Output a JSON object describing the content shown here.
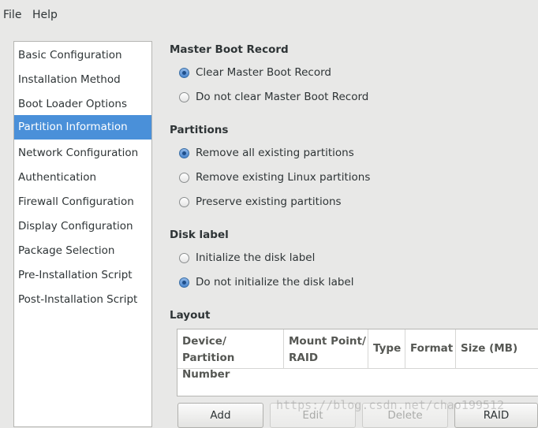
{
  "menu": {
    "file": "File",
    "help": "Help"
  },
  "sidebar": {
    "items": [
      {
        "label": "Basic Configuration",
        "selected": false
      },
      {
        "label": "Installation Method",
        "selected": false
      },
      {
        "label": "Boot Loader Options",
        "selected": false
      },
      {
        "label": "Partition Information",
        "selected": true
      },
      {
        "label": "Network Configuration",
        "selected": false
      },
      {
        "label": "Authentication",
        "selected": false
      },
      {
        "label": "Firewall Configuration",
        "selected": false
      },
      {
        "label": "Display Configuration",
        "selected": false
      },
      {
        "label": "Package Selection",
        "selected": false
      },
      {
        "label": "Pre-Installation Script",
        "selected": false
      },
      {
        "label": "Post-Installation Script",
        "selected": false
      }
    ]
  },
  "mbr": {
    "title": "Master Boot Record",
    "options": [
      {
        "label": "Clear Master Boot Record",
        "checked": true
      },
      {
        "label": "Do not clear Master Boot Record",
        "checked": false
      }
    ]
  },
  "partitions": {
    "title": "Partitions",
    "options": [
      {
        "label": "Remove all existing partitions",
        "checked": true
      },
      {
        "label": "Remove existing Linux partitions",
        "checked": false
      },
      {
        "label": "Preserve existing partitions",
        "checked": false
      }
    ]
  },
  "disklabel": {
    "title": "Disk label",
    "options": [
      {
        "label": "Initialize the disk label",
        "checked": false
      },
      {
        "label": "Do not initialize the disk label",
        "checked": true
      }
    ]
  },
  "layout": {
    "title": "Layout",
    "columns": {
      "device_l1": "Device/",
      "device_l2": "Partition Number",
      "mount_l1": "Mount Point/",
      "mount_l2": "RAID",
      "type": "Type",
      "format": "Format",
      "size": "Size (MB)"
    },
    "rows": []
  },
  "buttons": {
    "add": "Add",
    "edit": "Edit",
    "delete": "Delete",
    "raid": "RAID"
  },
  "watermark": "https://blog.csdn.net/chao199512",
  "colors": {
    "selection": "#4a90d9",
    "background": "#e8e8e7"
  }
}
